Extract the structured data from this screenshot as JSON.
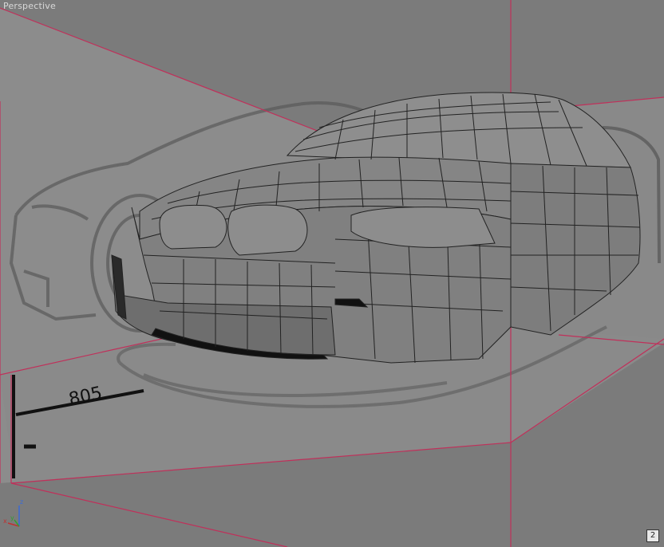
{
  "viewport": {
    "label": "Perspective",
    "page_number": "2",
    "dimension_label": "805"
  },
  "axis": {
    "z": "z",
    "x": "x",
    "y": "y"
  },
  "colors": {
    "background": "#7b7b7b",
    "plane_line": "#c0305a",
    "mesh_fill": "#8a8a8a",
    "mesh_edge": "#222222",
    "blueprint": "#9a9a9a"
  },
  "icons": [
    "view-axis-gizmo-icon"
  ]
}
